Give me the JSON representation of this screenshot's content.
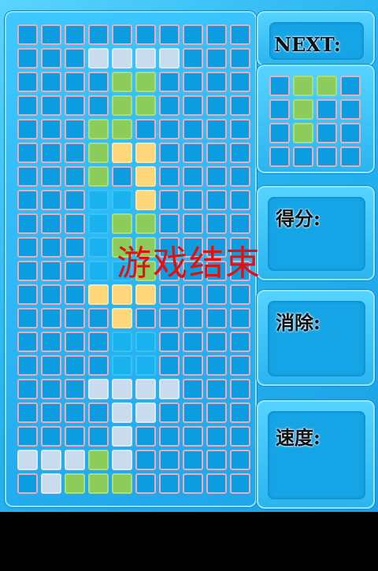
{
  "board": {
    "columns": 10,
    "rows": 20,
    "cells": [
      [
        "b",
        "b",
        "b",
        "b",
        "b",
        "b",
        "b",
        "b",
        "b",
        "b"
      ],
      [
        "b",
        "b",
        "b",
        "w",
        "w",
        "w",
        "w",
        "b",
        "b",
        "b"
      ],
      [
        "b",
        "b",
        "b",
        "b",
        "g",
        "g",
        "b",
        "b",
        "b",
        "b"
      ],
      [
        "b",
        "b",
        "b",
        "b",
        "g",
        "g",
        "b",
        "b",
        "b",
        "b"
      ],
      [
        "b",
        "b",
        "b",
        "g",
        "g",
        "b",
        "b",
        "b",
        "b",
        "b"
      ],
      [
        "b",
        "b",
        "b",
        "g",
        "y",
        "y",
        "b",
        "b",
        "b",
        "b"
      ],
      [
        "b",
        "b",
        "b",
        "g",
        "b",
        "y",
        "b",
        "b",
        "b",
        "b"
      ],
      [
        "b",
        "b",
        "b",
        "l",
        "l",
        "y",
        "b",
        "b",
        "b",
        "b"
      ],
      [
        "b",
        "b",
        "b",
        "l",
        "g",
        "g",
        "b",
        "b",
        "b",
        "b"
      ],
      [
        "b",
        "b",
        "b",
        "l",
        "g",
        "g",
        "b",
        "b",
        "b",
        "b"
      ],
      [
        "b",
        "b",
        "b",
        "l",
        "l",
        "g",
        "b",
        "b",
        "b",
        "b"
      ],
      [
        "b",
        "b",
        "b",
        "y",
        "y",
        "y",
        "b",
        "b",
        "b",
        "b"
      ],
      [
        "b",
        "b",
        "b",
        "b",
        "y",
        "b",
        "b",
        "b",
        "b",
        "b"
      ],
      [
        "b",
        "b",
        "b",
        "b",
        "l",
        "l",
        "b",
        "b",
        "b",
        "b"
      ],
      [
        "b",
        "b",
        "b",
        "b",
        "l",
        "l",
        "b",
        "b",
        "b",
        "b"
      ],
      [
        "b",
        "b",
        "b",
        "w",
        "w",
        "w",
        "w",
        "b",
        "b",
        "b"
      ],
      [
        "b",
        "b",
        "b",
        "b",
        "w",
        "w",
        "b",
        "b",
        "b",
        "b"
      ],
      [
        "b",
        "b",
        "b",
        "b",
        "w",
        "b",
        "b",
        "b",
        "b",
        "b"
      ],
      [
        "w",
        "w",
        "w",
        "g",
        "w",
        "b",
        "b",
        "b",
        "b",
        "b"
      ],
      [
        "b",
        "w",
        "g",
        "g",
        "g",
        "b",
        "b",
        "b",
        "b",
        "b"
      ]
    ]
  },
  "next_piece": {
    "label": "NEXT:",
    "cells": [
      [
        "b",
        "g",
        "g",
        "b"
      ],
      [
        "b",
        "g",
        "b",
        "b"
      ],
      [
        "b",
        "g",
        "b",
        "b"
      ],
      [
        "b",
        "b",
        "b",
        "b"
      ]
    ]
  },
  "stats": {
    "score_label": "得分:",
    "lines_label": "消除:",
    "speed_label": "速度:"
  },
  "overlay": {
    "message": "游戏结束"
  },
  "colors": {
    "empty": "#0b9de0",
    "white": "#c8dcee",
    "green": "#8bcc5a",
    "yellow": "#ffd77a",
    "light": "#19b2ef",
    "grid_line": "#f2a9b8",
    "game_over_text": "#e31010"
  }
}
